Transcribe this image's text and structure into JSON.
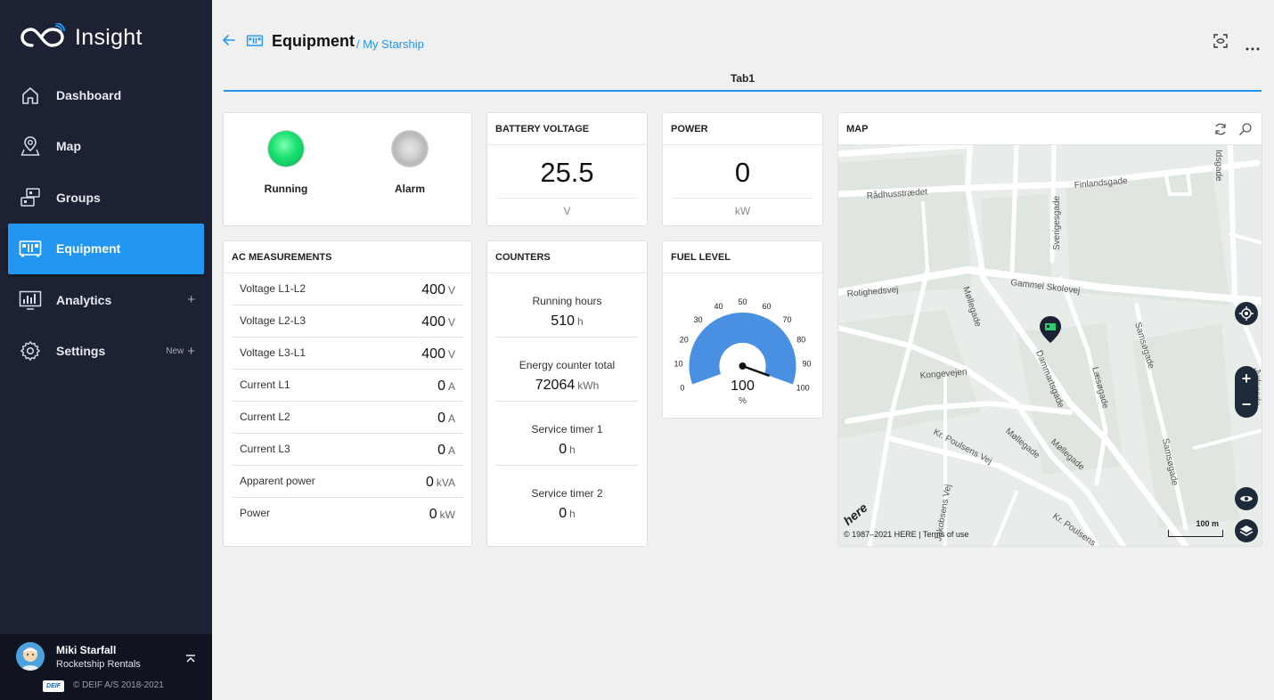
{
  "app": {
    "name": "Insight"
  },
  "sidebar": {
    "items": [
      {
        "label": "Dashboard",
        "icon": "home-icon",
        "active": false,
        "extra": ""
      },
      {
        "label": "Map",
        "icon": "map-pin-icon",
        "active": false,
        "extra": ""
      },
      {
        "label": "Groups",
        "icon": "groups-icon",
        "active": false,
        "extra": ""
      },
      {
        "label": "Equipment",
        "icon": "equipment-icon",
        "active": true,
        "extra": ""
      },
      {
        "label": "Analytics",
        "icon": "analytics-icon",
        "active": false,
        "extra": ""
      },
      {
        "label": "Settings",
        "icon": "gear-icon",
        "active": false,
        "extra": "New"
      }
    ],
    "user": {
      "name": "Miki Starfall",
      "org": "Rocketship Rentals"
    },
    "brand": "DEIF",
    "copyright": "© DEIF A/S 2018-2021"
  },
  "header": {
    "title": "Equipment",
    "breadcrumb": "/ My Starship"
  },
  "tabs": [
    {
      "label": "Tab1",
      "active": true
    }
  ],
  "status": {
    "running_label": "Running",
    "running_on": true,
    "alarm_label": "Alarm",
    "alarm_on": false
  },
  "battery": {
    "title": "BATTERY VOLTAGE",
    "value": "25.5",
    "unit": "V"
  },
  "power": {
    "title": "POWER",
    "value": "0",
    "unit": "kW"
  },
  "ac": {
    "title": "AC MEASUREMENTS",
    "rows": [
      {
        "label": "Voltage L1-L2",
        "value": "400",
        "unit": "V"
      },
      {
        "label": "Voltage L2-L3",
        "value": "400",
        "unit": "V"
      },
      {
        "label": "Voltage L3-L1",
        "value": "400",
        "unit": "V"
      },
      {
        "label": "Current L1",
        "value": "0",
        "unit": "A"
      },
      {
        "label": "Current L2",
        "value": "0",
        "unit": "A"
      },
      {
        "label": "Current L3",
        "value": "0",
        "unit": "A"
      },
      {
        "label": "Apparent power",
        "value": "0",
        "unit": "kVA"
      },
      {
        "label": "Power",
        "value": "0",
        "unit": "kW"
      }
    ]
  },
  "counters": {
    "title": "COUNTERS",
    "rows": [
      {
        "label": "Running hours",
        "value": "510",
        "unit": "h"
      },
      {
        "label": "Energy counter total",
        "value": "72064",
        "unit": "kWh"
      },
      {
        "label": "Service timer 1",
        "value": "0",
        "unit": "h"
      },
      {
        "label": "Service timer 2",
        "value": "0",
        "unit": "h"
      }
    ]
  },
  "fuel": {
    "title": "FUEL LEVEL",
    "value": 100,
    "unit": "%",
    "ticks": [
      "0",
      "10",
      "20",
      "30",
      "40",
      "50",
      "60",
      "70",
      "80",
      "90",
      "100"
    ],
    "min": 0,
    "max": 100,
    "fill_color": "#4a90e2"
  },
  "map": {
    "title": "MAP",
    "streets": [
      "Rådhusstrædet",
      "Finlandsgade",
      "Sverigesgade",
      "Gammel Skolevej",
      "Rotighedsvej",
      "Møllegade",
      "Kongevejen",
      "Dammartsgade",
      "Læsøgade",
      "Samsøgade",
      "Kr. Poulsens Vej",
      "Jakobsens Vej",
      "Kr. Poulsens",
      "Jydsgade",
      "Idsgade"
    ],
    "attribution": "© 1987–2021 HERE | Terms of use",
    "provider": "here",
    "scale": "100 m"
  },
  "colors": {
    "accent": "#2196f3",
    "sidebar_bg": "#1c2233",
    "running": "#19e070"
  }
}
